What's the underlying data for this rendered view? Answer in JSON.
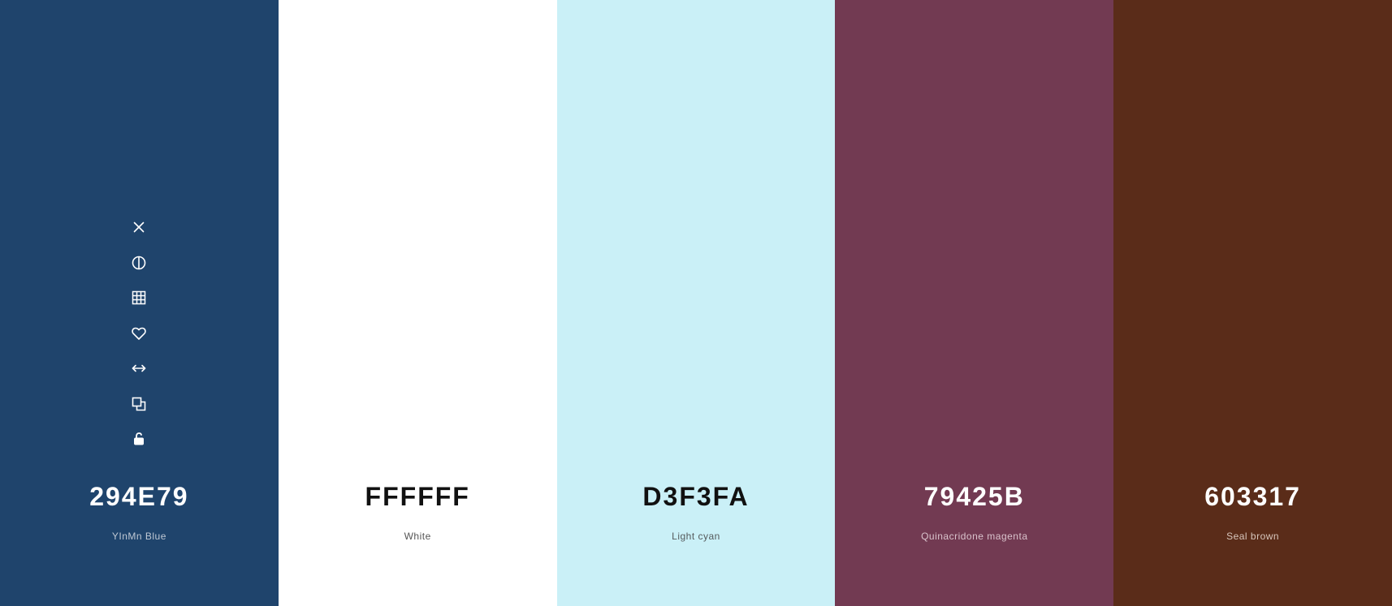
{
  "swatches": [
    {
      "hex": "294E79",
      "name": "YInMn Blue",
      "color": "#1F446C",
      "text_color": "#FFFFFF",
      "name_color": "#BFC8D4"
    },
    {
      "hex": "FFFFFF",
      "name": "White",
      "color": "#FFFFFF",
      "text_color": "#111111",
      "name_color": "#555555"
    },
    {
      "hex": "D3F3FA",
      "name": "Light cyan",
      "color": "#CAF0F7",
      "text_color": "#111111",
      "name_color": "#555A5C"
    },
    {
      "hex": "79425B",
      "name": "Quinacridone magenta",
      "color": "#723A52",
      "text_color": "#FFFFFF",
      "name_color": "#D9C3CC"
    },
    {
      "hex": "603317",
      "name": "Seal brown",
      "color": "#5A2C19",
      "text_color": "#FFFFFF",
      "name_color": "#D7C6BC"
    }
  ],
  "toolbar": {
    "icons": [
      "close-icon",
      "contrast-icon",
      "grid-icon",
      "heart-icon",
      "arrows-horizontal-icon",
      "copy-icon",
      "unlock-icon"
    ]
  }
}
